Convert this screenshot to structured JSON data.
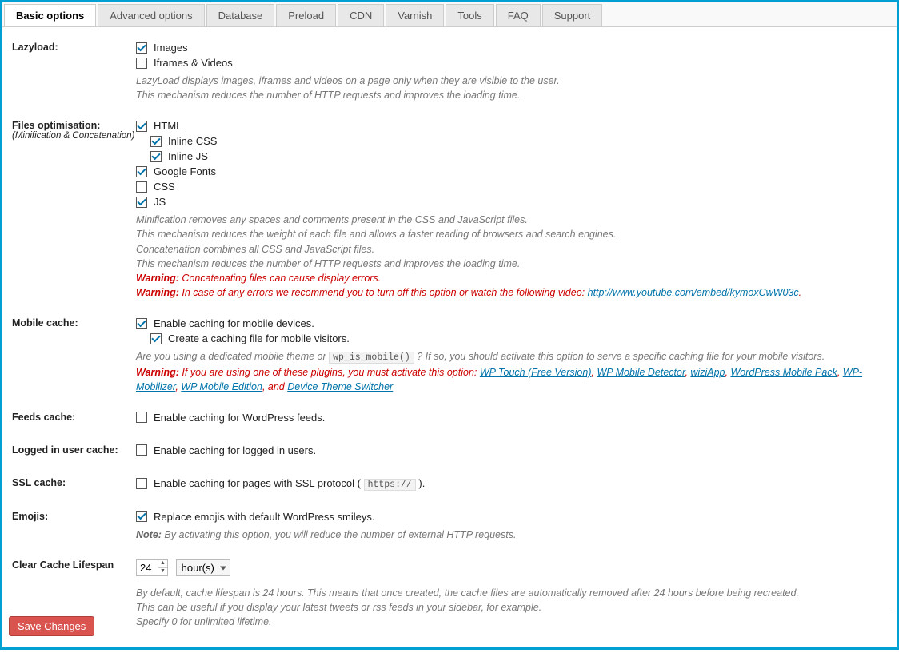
{
  "tabs": [
    "Basic options",
    "Advanced options",
    "Database",
    "Preload",
    "CDN",
    "Varnish",
    "Tools",
    "FAQ",
    "Support"
  ],
  "active_tab": 0,
  "sections": {
    "lazyload": {
      "label": "Lazyload:",
      "opts": {
        "images": {
          "label": "Images",
          "checked": true
        },
        "iframes": {
          "label": "Iframes & Videos",
          "checked": false
        }
      },
      "desc1": "LazyLoad displays images, iframes and videos on a page only when they are visible to the user.",
      "desc2": "This mechanism reduces the number of HTTP requests and improves the loading time."
    },
    "files": {
      "label": "Files optimisation:",
      "sublabel": "(Minification & Concatenation)",
      "opts": {
        "html": {
          "label": "HTML",
          "checked": true
        },
        "inline_css": {
          "label": "Inline CSS",
          "checked": true,
          "indent": true
        },
        "inline_js": {
          "label": "Inline JS",
          "checked": true,
          "indent": true
        },
        "google_fonts": {
          "label": "Google Fonts",
          "checked": true
        },
        "css": {
          "label": "CSS",
          "checked": false
        },
        "js": {
          "label": "JS",
          "checked": true
        }
      },
      "d1": "Minification removes any spaces and comments present in the CSS and JavaScript files.",
      "d2": "This mechanism reduces the weight of each file and allows a faster reading of browsers and search engines.",
      "d3": "Concatenation combines all CSS and JavaScript files.",
      "d4": "This mechanism reduces the number of HTTP requests and improves the loading time.",
      "w1_prefix": "Warning:",
      "w1": " Concatenating files can cause display errors.",
      "w2_prefix": "Warning:",
      "w2_a": " In case of any errors we recommend you to turn off this option or watch the following video: ",
      "w2_link": "http://www.youtube.com/embed/kymoxCwW03c",
      "w2_dot": "."
    },
    "mobile": {
      "label": "Mobile cache:",
      "opt1": {
        "label": "Enable caching for mobile devices.",
        "checked": true
      },
      "opt2": {
        "label": "Create a caching file for mobile visitors.",
        "checked": true
      },
      "d1a": "Are you using a dedicated mobile theme or ",
      "d1code": "wp_is_mobile()",
      "d1b": " ? If so, you should activate this option to serve a specific caching file for your mobile visitors.",
      "w_prefix": "Warning:",
      "w_a": " If you are using one of these plugins, you must activate this option: ",
      "plugins": [
        "WP Touch (Free Version)",
        "WP Mobile Detector",
        "wiziApp",
        "WordPress Mobile Pack",
        "WP-Mobilizer",
        "WP Mobile Edition"
      ],
      "and": ", and ",
      "last_plugin": "Device Theme Switcher"
    },
    "feeds": {
      "label": "Feeds cache:",
      "opt": {
        "label": "Enable caching for WordPress feeds.",
        "checked": false
      }
    },
    "logged": {
      "label": "Logged in user cache:",
      "opt": {
        "label": "Enable caching for logged in users.",
        "checked": false
      }
    },
    "ssl": {
      "label": "SSL cache:",
      "opt_a": "Enable caching for pages with SSL protocol ( ",
      "opt_code": "https://",
      "opt_b": " ).",
      "checked": false
    },
    "emojis": {
      "label": "Emojis:",
      "opt": {
        "label": "Replace emojis with default WordPress smileys.",
        "checked": true
      },
      "note_prefix": "Note:",
      "note": " By activating this option, you will reduce the number of external HTTP requests."
    },
    "lifespan": {
      "label": "Clear Cache Lifespan",
      "value": "24",
      "unit": "hour(s)",
      "d1": "By default, cache lifespan is 24 hours. This means that once created, the cache files are automatically removed after 24 hours before being recreated.",
      "d2": "This can be useful if you display your latest tweets or rss feeds in your sidebar, for example.",
      "d3": "Specify 0 for unlimited lifetime."
    }
  },
  "save_label": "Save Changes"
}
